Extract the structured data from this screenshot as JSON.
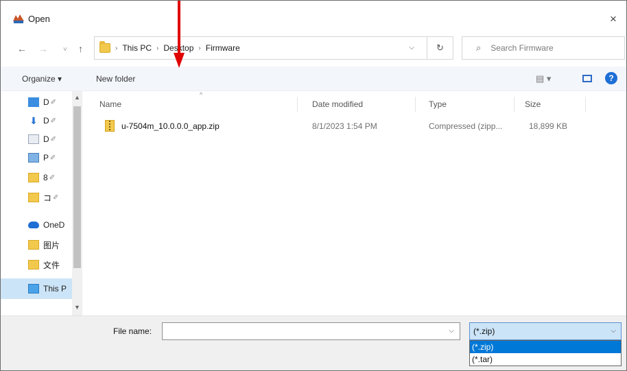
{
  "window": {
    "title": "Open",
    "close": "×"
  },
  "nav": {
    "back": "←",
    "forward": "→",
    "recent": "˅",
    "up": "↑"
  },
  "address": {
    "crumbs": [
      "This PC",
      "Desktop",
      "Firmware"
    ],
    "separator": "›",
    "dropdown": "⌵",
    "refresh": "↻"
  },
  "search": {
    "placeholder": "Search Firmware",
    "icon": "⌕"
  },
  "toolbar": {
    "organize": "Organize ▾",
    "new_folder": "New folder",
    "view": "▤ ▾",
    "help": "?"
  },
  "sidebar": {
    "pin": "✐",
    "items": [
      {
        "label": "D",
        "icon": "desktop-icon"
      },
      {
        "label": "D",
        "icon": "downloads-icon"
      },
      {
        "label": "D",
        "icon": "documents-icon"
      },
      {
        "label": "P",
        "icon": "pictures-icon"
      },
      {
        "label": "8",
        "icon": "folder-icon"
      },
      {
        "label": "コ",
        "icon": "folder-icon"
      },
      {
        "label": "OneD",
        "icon": "onedrive-icon"
      },
      {
        "label": "图片",
        "icon": "folder-icon"
      },
      {
        "label": "文件",
        "icon": "folder-icon"
      },
      {
        "label": "This P",
        "icon": "this-pc-icon"
      }
    ],
    "scroll_up": "▲",
    "scroll_down": "▼"
  },
  "columns": {
    "name": "Name",
    "date": "Date modified",
    "type": "Type",
    "size": "Size",
    "sort": "^"
  },
  "files": [
    {
      "name": "u-7504m_10.0.0.0_app.zip",
      "date": "8/1/2023 1:54 PM",
      "type": "Compressed (zipp...",
      "size": "18,899 KB"
    }
  ],
  "footer": {
    "file_name_label": "File name:",
    "file_name_value": "",
    "dropdown": "⌵",
    "file_type_selected": "(*.zip)",
    "file_type_options": [
      "(*.zip)",
      "(*.tar)"
    ]
  },
  "colors": {
    "accent": "#0078d7",
    "annotation_arrow": "#e00000"
  }
}
